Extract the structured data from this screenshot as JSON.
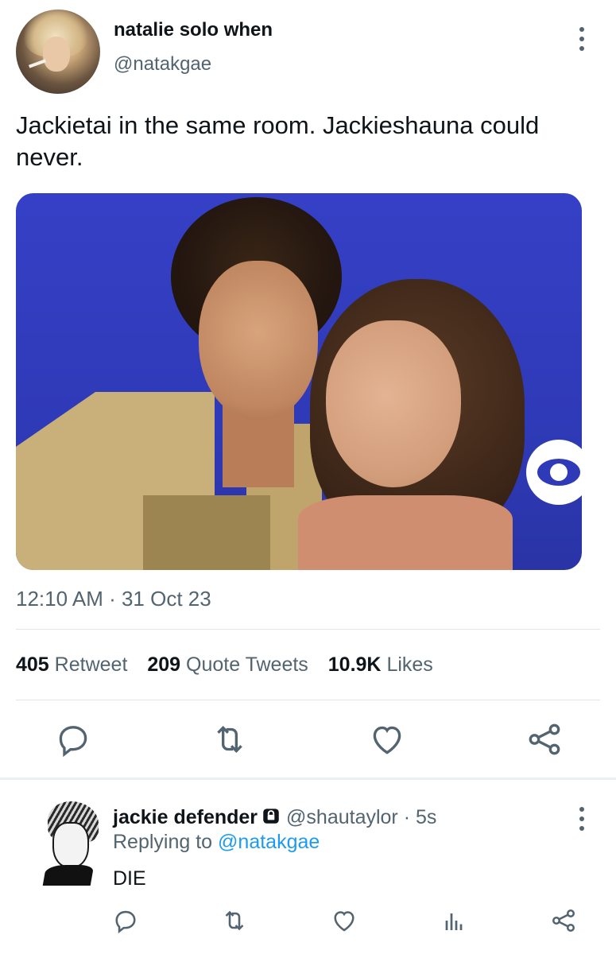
{
  "tweet": {
    "display_name": "natalie solo when",
    "handle": "@natakgae",
    "text": "Jackietai in the same room. Jackieshauna could never.",
    "timestamp": "12:10 AM · 31 Oct 23",
    "stats": {
      "retweets_count": "405",
      "retweets_label": "Retweet",
      "quotes_count": "209",
      "quotes_label": "Quote Tweets",
      "likes_count": "10.9K",
      "likes_label": "Likes"
    },
    "actions": [
      "reply-icon",
      "retweet-icon",
      "like-icon",
      "share-icon"
    ]
  },
  "reply": {
    "display_name": "jackie defender",
    "handle_time": "@shautaylor · 5s",
    "replying_prefix": "Replying to",
    "replying_to": "@natakgae",
    "text": "DIE",
    "actions": [
      "reply-icon",
      "retweet-icon",
      "like-icon",
      "views-icon",
      "share-icon"
    ]
  },
  "colors": {
    "text": "#0f1419",
    "secondary": "#536471",
    "link": "#1d9bf0",
    "photo_backdrop": "#3540c6"
  }
}
